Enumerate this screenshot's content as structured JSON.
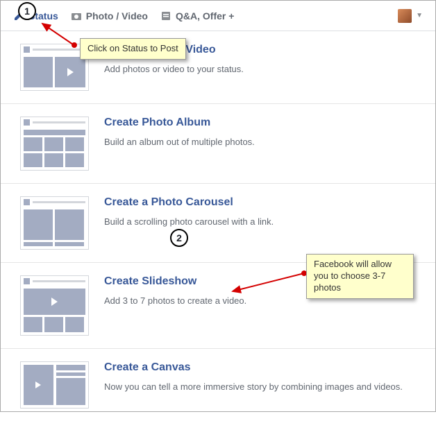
{
  "topbar": {
    "status_label": "Status",
    "photo_video_label": "Photo / Video",
    "qa_offer_label": "Q&A, Offer +"
  },
  "options": [
    {
      "title": "Upload Photos/Video",
      "desc": "Add photos or video to your status."
    },
    {
      "title": "Create Photo Album",
      "desc": "Build an album out of multiple photos."
    },
    {
      "title": "Create a Photo Carousel",
      "desc": "Build a scrolling photo carousel with a link."
    },
    {
      "title": "Create Slideshow",
      "desc": "Add 3 to 7 photos to create a video."
    },
    {
      "title": "Create a Canvas",
      "desc": "Now you can tell a more immersive story by combining images and videos."
    }
  ],
  "annotations": {
    "step1": "1",
    "step2": "2",
    "note1": "Click on Status to Post",
    "note2": "Facebook will allow you to choose 3-7 photos"
  }
}
